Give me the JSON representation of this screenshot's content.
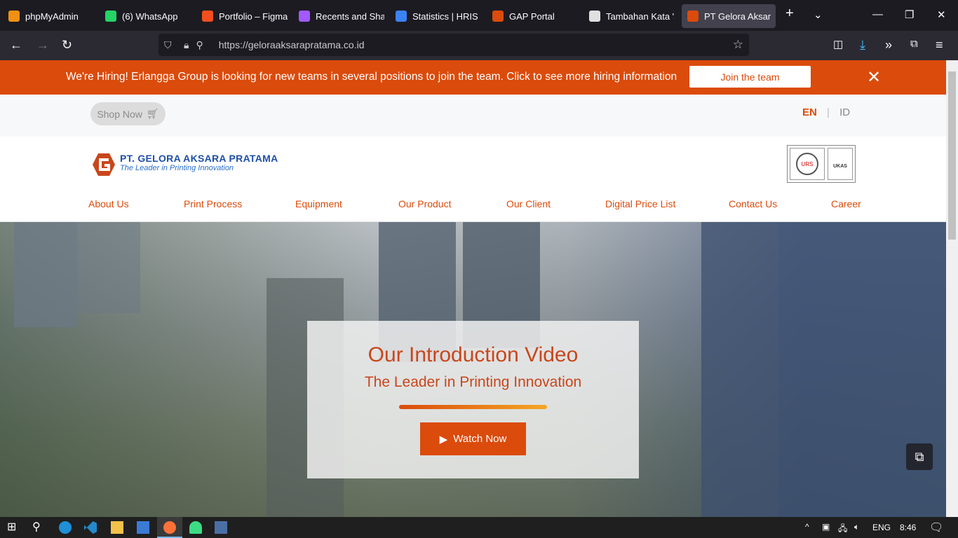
{
  "browser": {
    "tabs": [
      {
        "label": "phpMyAdmin",
        "color": "#f29111"
      },
      {
        "label": "(6) WhatsApp",
        "color": "#25d366"
      },
      {
        "label": "Portfolio – Figma",
        "color": "#f24e1e"
      },
      {
        "label": "Recents and Shari",
        "color": "#a259ff"
      },
      {
        "label": "Statistics | HRIS M",
        "color": "#3b82f6"
      },
      {
        "label": "GAP Portal",
        "color": "#db4b0b"
      },
      {
        "label": "Tambahan Kata 'S",
        "color": "#e0e0e0"
      },
      {
        "label": "PT Gelora Aksar",
        "color": "#db4b0b"
      }
    ],
    "url": "https://geloraaksarapratama.co.id"
  },
  "banner": {
    "text": "We're Hiring! Erlangga Group is looking for new teams in several positions to join the team. Click to see more hiring information",
    "button": "Join the team"
  },
  "topbar": {
    "shop": "Shop Now",
    "lang_en": "EN",
    "lang_sep": "|",
    "lang_id": "ID"
  },
  "logo": {
    "name": "PT. GELORA AKSARA PRATAMA",
    "tagline": "The Leader in Printing Innovation",
    "cert": "UKAS",
    "cert_sub": "URS"
  },
  "menu": [
    "About Us",
    "Print Process",
    "Equipment",
    "Our Product",
    "Our Client",
    "Digital Price List",
    "Contact Us",
    "Career"
  ],
  "hero": {
    "title": "Our Introduction Video",
    "subtitle": "The Leader in Printing Innovation",
    "button": "Watch Now"
  },
  "taskbar": {
    "lang": "ENG",
    "time": "8:46"
  },
  "colors": {
    "brand": "#db4b0b"
  }
}
